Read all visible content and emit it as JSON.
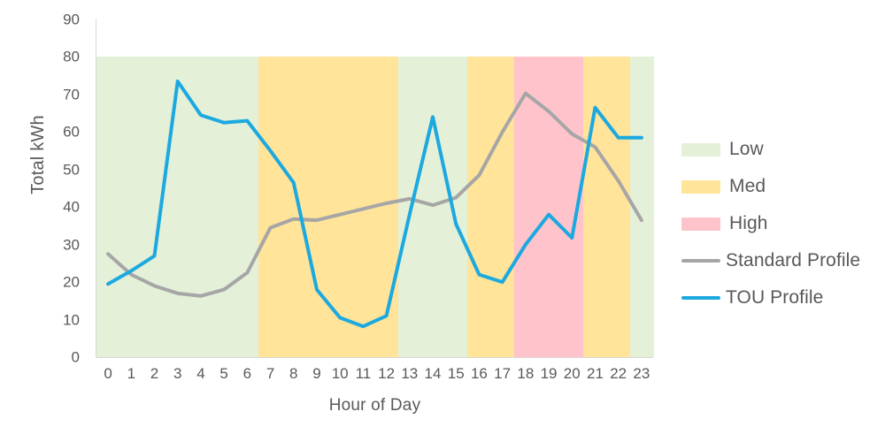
{
  "chart_data": {
    "type": "line",
    "title": "",
    "xlabel": "Hour of Day",
    "ylabel": "Total kWh",
    "x": [
      0,
      1,
      2,
      3,
      4,
      5,
      6,
      7,
      8,
      9,
      10,
      11,
      12,
      13,
      14,
      15,
      16,
      17,
      18,
      19,
      20,
      21,
      22,
      23
    ],
    "xtick_labels": [
      "0",
      "1",
      "2",
      "3",
      "4",
      "5",
      "6",
      "7",
      "8",
      "9",
      "10",
      "11",
      "12",
      "13",
      "14",
      "15",
      "16",
      "17",
      "18",
      "19",
      "20",
      "21",
      "22",
      "23"
    ],
    "ytick_labels": [
      "0",
      "10",
      "20",
      "30",
      "40",
      "50",
      "60",
      "70",
      "80",
      "90"
    ],
    "yticks": [
      0,
      10,
      20,
      30,
      40,
      50,
      60,
      70,
      80,
      90
    ],
    "ylim": [
      0,
      90
    ],
    "xlim": [
      -0.5,
      23.5
    ],
    "grid": false,
    "legend_position": "right",
    "series": [
      {
        "name": "Standard Profile",
        "color": "#A6A6A6",
        "values": [
          27.5,
          22.0,
          19.0,
          17.0,
          16.3,
          18.0,
          22.5,
          34.5,
          36.8,
          36.5,
          38.0,
          39.5,
          41.0,
          42.2,
          40.5,
          42.5,
          48.5,
          60.0,
          70.3,
          65.5,
          59.5,
          56.0,
          47.0,
          36.5
        ]
      },
      {
        "name": "TOU Profile",
        "color": "#1CA9E0",
        "values": [
          19.5,
          23.0,
          27.0,
          73.5,
          64.5,
          62.5,
          63.0,
          55.0,
          46.5,
          18.0,
          10.5,
          8.2,
          11.0,
          38.0,
          64.0,
          35.5,
          22.0,
          20.0,
          30.0,
          38.0,
          31.8,
          66.5,
          58.5,
          58.5
        ]
      }
    ],
    "bands": [
      {
        "name": "Low",
        "color": "#E5F0D8",
        "start": -0.5,
        "end": 6.5,
        "top": 80
      },
      {
        "name": "Med",
        "color": "#FFE49A",
        "start": 6.5,
        "end": 12.5,
        "top": 80
      },
      {
        "name": "Low",
        "color": "#E5F0D8",
        "start": 12.5,
        "end": 15.5,
        "top": 80
      },
      {
        "name": "Med",
        "color": "#FFE49A",
        "start": 15.5,
        "end": 17.5,
        "top": 80
      },
      {
        "name": "High",
        "color": "#FFC4CB",
        "start": 17.5,
        "end": 20.5,
        "top": 80
      },
      {
        "name": "Med",
        "color": "#FFE49A",
        "start": 20.5,
        "end": 22.5,
        "top": 80
      },
      {
        "name": "Low",
        "color": "#E5F0D8",
        "start": 22.5,
        "end": 23.5,
        "top": 80
      }
    ],
    "legend": [
      {
        "label": "Low",
        "type": "swatch",
        "color": "#E5F0D8"
      },
      {
        "label": "Med",
        "type": "swatch",
        "color": "#FFE49A"
      },
      {
        "label": "High",
        "type": "swatch",
        "color": "#FFC4CB"
      },
      {
        "label": "Standard Profile",
        "type": "line",
        "color": "#A6A6A6"
      },
      {
        "label": "TOU Profile",
        "type": "line",
        "color": "#1CA9E0"
      }
    ]
  }
}
